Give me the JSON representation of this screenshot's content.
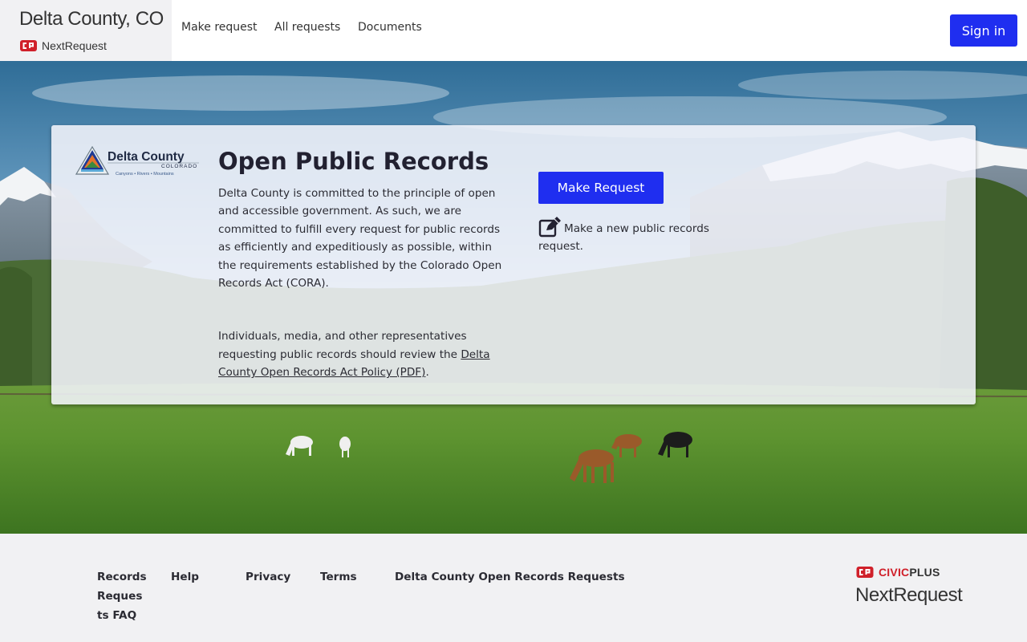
{
  "header": {
    "agency_name": "Delta County, CO",
    "product_name": "NextRequest",
    "nav": [
      {
        "label": "Make request"
      },
      {
        "label": "All requests"
      },
      {
        "label": "Documents"
      }
    ],
    "sign_in_label": "Sign in"
  },
  "hero": {
    "logo": {
      "name": "Delta County",
      "state": "COLORADO",
      "tagline": "Canyons • Rivers • Mountains"
    },
    "title": "Open Public Records",
    "intro": "Delta County is committed to the principle of open and accessible government. As such, we are committed to fulfill every request for public records as efficiently and expeditiously as possible, within the requirements established by the Colorado Open Records Act (CORA).",
    "policy_prefix": "Individuals, media, and other representatives requesting public records should review the ",
    "policy_link": "Delta County Open Records Act Policy (PDF)",
    "policy_suffix": ".",
    "make_request_button": "Make Request",
    "make_request_icon": "edit-icon",
    "make_request_desc": "Make a new public records request."
  },
  "footer": {
    "links": [
      {
        "label": "Records Requests FAQ"
      },
      {
        "label": "Help"
      },
      {
        "label": "Privacy"
      },
      {
        "label": "Terms"
      },
      {
        "label": "Delta County Open Records Requests"
      }
    ],
    "brand_civic": "CIVIC",
    "brand_plus": "PLUS",
    "brand_product": "NextRequest"
  },
  "colors": {
    "primary_button": "#1f2ef0",
    "brand_red": "#d0202a",
    "title_text": "#222131"
  }
}
